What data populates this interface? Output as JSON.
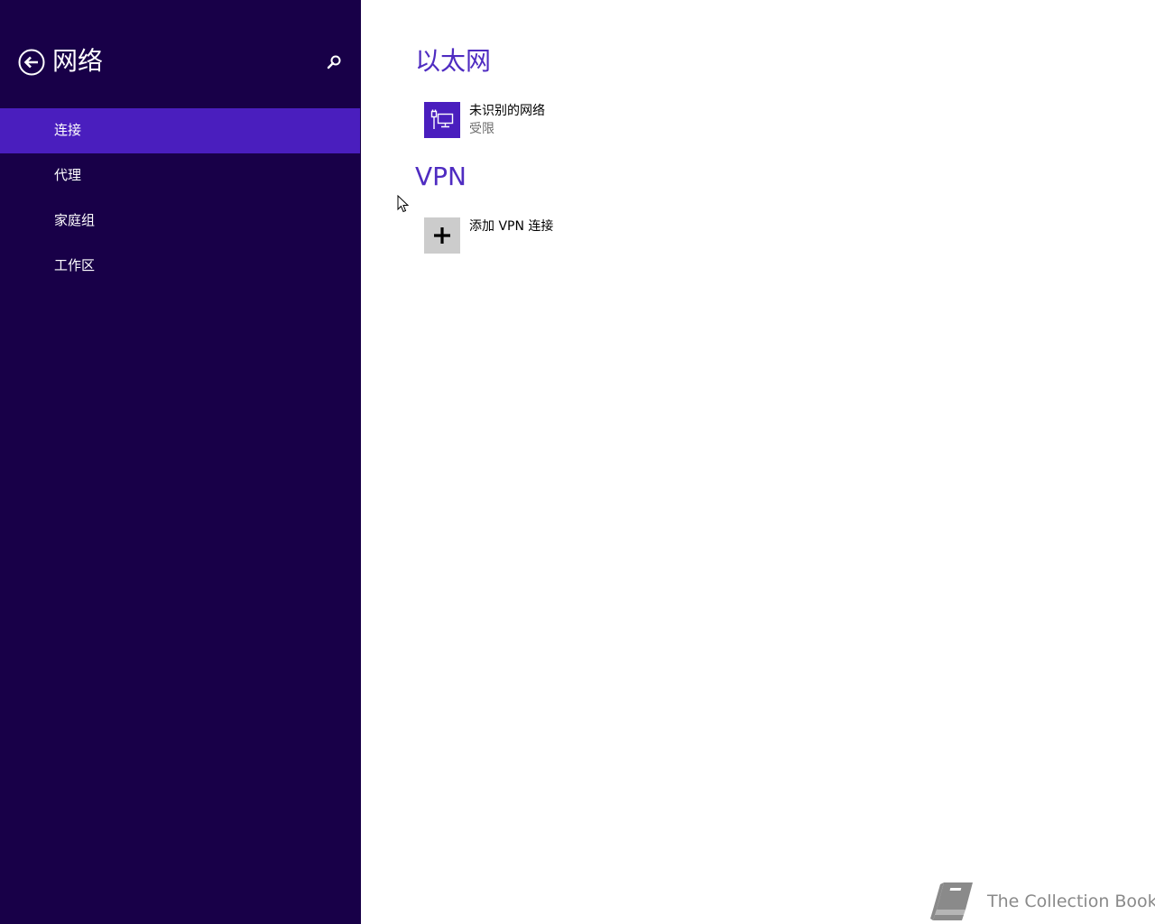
{
  "sidebar": {
    "title": "网络",
    "back_icon": "back-arrow-circle-icon",
    "search_icon": "search-icon",
    "items": [
      {
        "label": "连接",
        "active": true
      },
      {
        "label": "代理",
        "active": false
      },
      {
        "label": "家庭组",
        "active": false
      },
      {
        "label": "工作区",
        "active": false
      }
    ]
  },
  "main": {
    "ethernet": {
      "title": "以太网",
      "network": {
        "name": "未识别的网络",
        "status": "受限",
        "icon": "ethernet-network-icon"
      }
    },
    "vpn": {
      "title": "VPN",
      "add": {
        "label": "添加 VPN 连接",
        "icon": "plus-icon"
      }
    }
  },
  "watermark": {
    "text": "The Collection Book",
    "icon": "book-icon"
  },
  "colors": {
    "sidebar_bg": "#180048",
    "accent": "#4a1ebe",
    "section_title": "#4f2cc1",
    "tile_grey": "#cccccc"
  }
}
